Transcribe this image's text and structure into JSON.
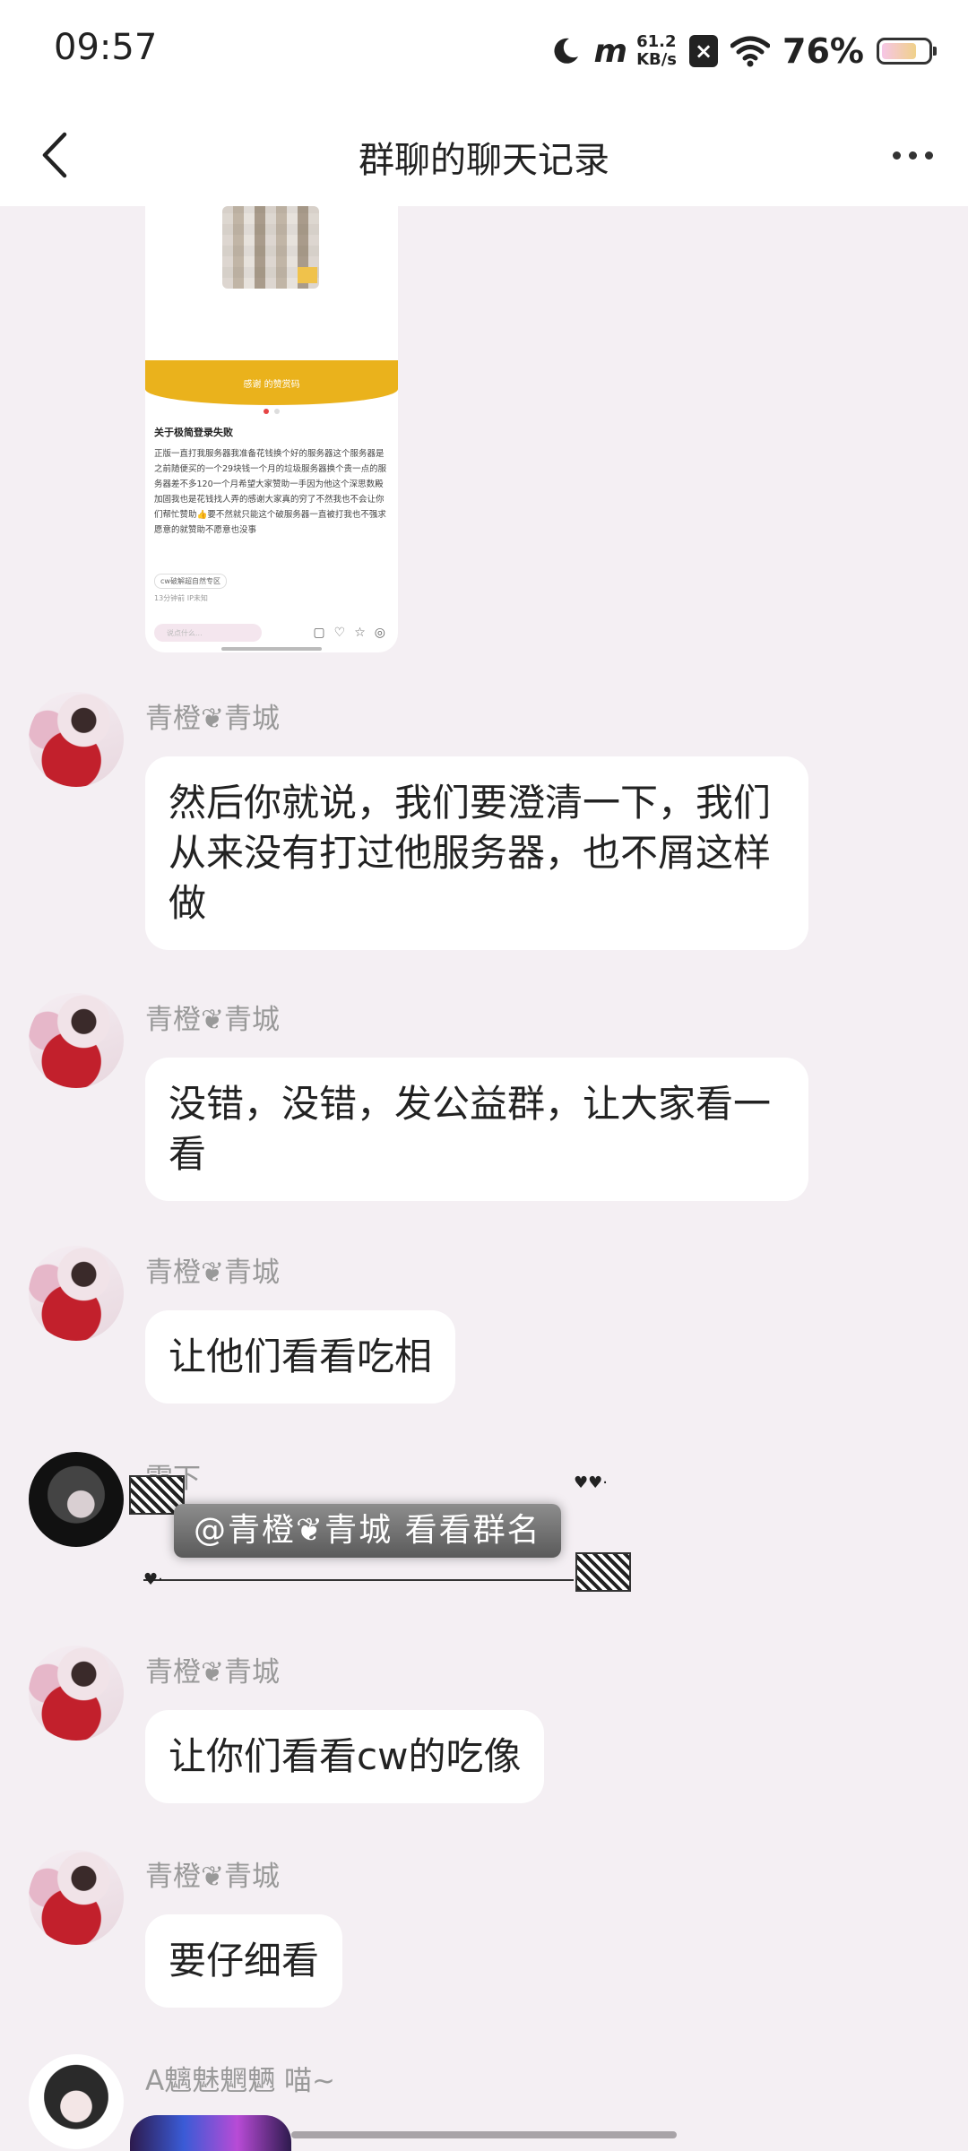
{
  "status_bar": {
    "time": "09:57",
    "net_speed_value": "61.2",
    "net_speed_unit": "KB/s",
    "battery_percent": "76%",
    "battery_level": 0.76
  },
  "header": {
    "title": "群聊的聊天记录"
  },
  "shared_post": {
    "band_text": "感谢 的赞赏码",
    "title": "关于极简登录失败",
    "body": "正版一直打我服务器我准备花钱换个好的服务器这个服务器是之前随便买的一个29块钱一个月的垃圾服务器换个贵一点的服务器差不多120一个月希望大家赞助一手因为他这个深思数殿加固我也是花钱找人弄的感谢大家真的穷了不然我也不会让你们帮忙赞助👍要不然就只能这个破服务器一直被打我也不强求愿意的就赞助不愿意也没事",
    "tag": "cw破解超自然专区",
    "meta": "13分钟前 IP未知",
    "comment_placeholder": "说点什么..."
  },
  "messages": [
    {
      "sender": "青橙❦青城",
      "text": "然后你就说，我们要澄清一下，我们从来没有打过他服务器，也不屑这样做"
    },
    {
      "sender": "青橙❦青城",
      "text": "没错，没错，发公益群，让大家看一看"
    },
    {
      "sender": "青橙❦青城",
      "text": "让他们看看吃相"
    },
    {
      "sender": "零下",
      "sticker_text": "@青橙❦青城 看看群名"
    },
    {
      "sender": "青橙❦青城",
      "text": "让你们看看cw的吃像"
    },
    {
      "sender": "青橙❦青城",
      "text": "要仔细看"
    },
    {
      "sender": "A魑魅魍魉 喵~"
    }
  ]
}
